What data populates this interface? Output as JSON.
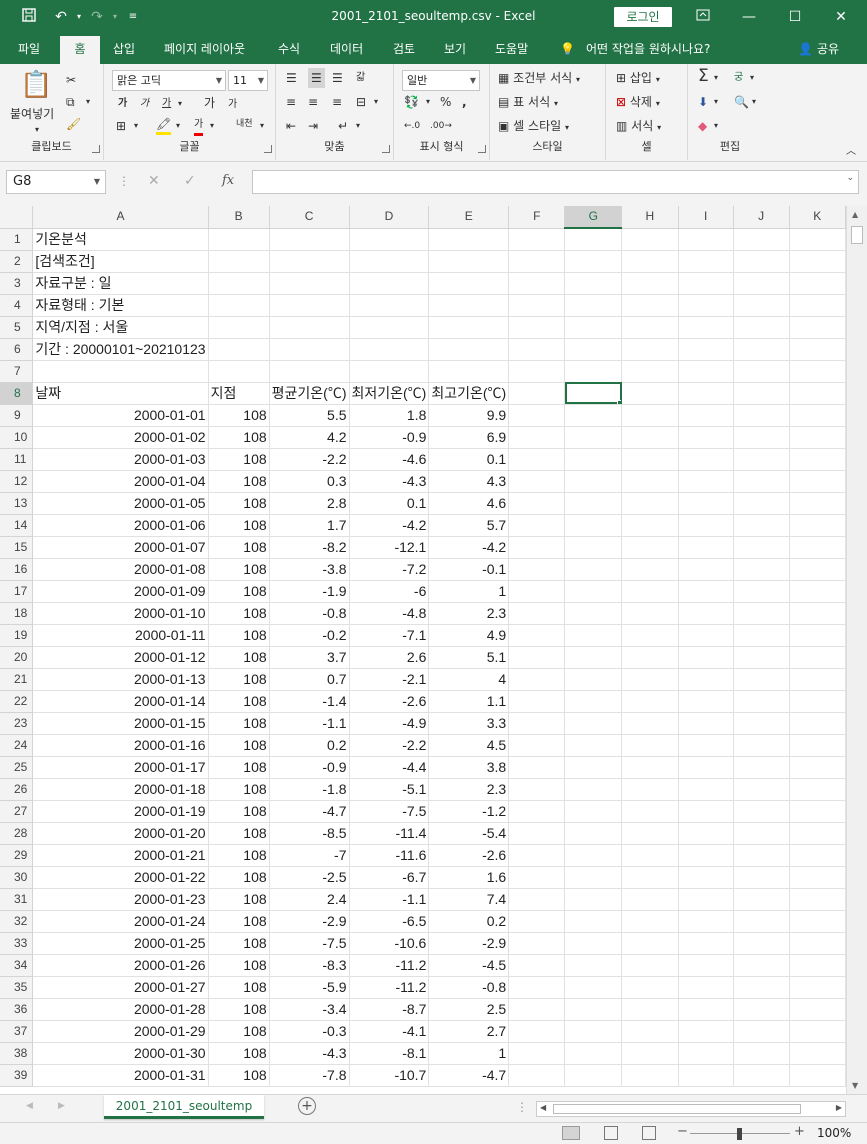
{
  "window": {
    "title": "2001_2101_seoultemp.csv  -  Excel",
    "login": "로그인",
    "accent": "#217346"
  },
  "tabs": [
    "파일",
    "홈",
    "삽입",
    "페이지 레이아웃",
    "수식",
    "데이터",
    "검토",
    "보기",
    "도움말"
  ],
  "tellme": "어떤 작업을 원하시나요?",
  "share": "공유",
  "ribbon": {
    "clipboard": {
      "paste": "붙여넣기",
      "label": "클립보드"
    },
    "font": {
      "name": "맑은 고딕",
      "size": "11",
      "label": "글꼴",
      "bold": "가",
      "italic": "가",
      "underline": "가",
      "grow": "가",
      "shrink": "가",
      "phonetic": "내천"
    },
    "align": {
      "label": "맞춤",
      "wrap": "갋"
    },
    "number": {
      "format": "일반",
      "label": "표시 형식"
    },
    "styles": {
      "conditional": "조건부 서식",
      "table": "표 서식",
      "cell": "셀 스타일",
      "label": "스타일"
    },
    "cells": {
      "insert": "삽입",
      "delete": "삭제",
      "format": "서식",
      "label": "셀"
    },
    "editing": {
      "label": "편집",
      "sort": "궁"
    }
  },
  "formula": {
    "namebox": "G8",
    "value": ""
  },
  "columns": [
    "A",
    "B",
    "C",
    "D",
    "E",
    "F",
    "G",
    "H",
    "I",
    "J",
    "K"
  ],
  "selected_column": "G",
  "selected_row": 8,
  "header_rows": [
    "기온분석",
    "[검색조건]",
    "자료구분 : 일",
    "자료형태 : 기본",
    "지역/지점 : 서울",
    "기간 : 20000101~20210123",
    ""
  ],
  "table_header": [
    "날짜",
    "지점",
    "평균기온(℃)",
    "최저기온(℃)",
    "최고기온(℃)"
  ],
  "rows": [
    [
      "2000-01-01",
      "108",
      "5.5",
      "1.8",
      "9.9"
    ],
    [
      "2000-01-02",
      "108",
      "4.2",
      "-0.9",
      "6.9"
    ],
    [
      "2000-01-03",
      "108",
      "-2.2",
      "-4.6",
      "0.1"
    ],
    [
      "2000-01-04",
      "108",
      "0.3",
      "-4.3",
      "4.3"
    ],
    [
      "2000-01-05",
      "108",
      "2.8",
      "0.1",
      "4.6"
    ],
    [
      "2000-01-06",
      "108",
      "1.7",
      "-4.2",
      "5.7"
    ],
    [
      "2000-01-07",
      "108",
      "-8.2",
      "-12.1",
      "-4.2"
    ],
    [
      "2000-01-08",
      "108",
      "-3.8",
      "-7.2",
      "-0.1"
    ],
    [
      "2000-01-09",
      "108",
      "-1.9",
      "-6",
      "1"
    ],
    [
      "2000-01-10",
      "108",
      "-0.8",
      "-4.8",
      "2.3"
    ],
    [
      "2000-01-11",
      "108",
      "-0.2",
      "-7.1",
      "4.9"
    ],
    [
      "2000-01-12",
      "108",
      "3.7",
      "2.6",
      "5.1"
    ],
    [
      "2000-01-13",
      "108",
      "0.7",
      "-2.1",
      "4"
    ],
    [
      "2000-01-14",
      "108",
      "-1.4",
      "-2.6",
      "1.1"
    ],
    [
      "2000-01-15",
      "108",
      "-1.1",
      "-4.9",
      "3.3"
    ],
    [
      "2000-01-16",
      "108",
      "0.2",
      "-2.2",
      "4.5"
    ],
    [
      "2000-01-17",
      "108",
      "-0.9",
      "-4.4",
      "3.8"
    ],
    [
      "2000-01-18",
      "108",
      "-1.8",
      "-5.1",
      "2.3"
    ],
    [
      "2000-01-19",
      "108",
      "-4.7",
      "-7.5",
      "-1.2"
    ],
    [
      "2000-01-20",
      "108",
      "-8.5",
      "-11.4",
      "-5.4"
    ],
    [
      "2000-01-21",
      "108",
      "-7",
      "-11.6",
      "-2.6"
    ],
    [
      "2000-01-22",
      "108",
      "-2.5",
      "-6.7",
      "1.6"
    ],
    [
      "2000-01-23",
      "108",
      "2.4",
      "-1.1",
      "7.4"
    ],
    [
      "2000-01-24",
      "108",
      "-2.9",
      "-6.5",
      "0.2"
    ],
    [
      "2000-01-25",
      "108",
      "-7.5",
      "-10.6",
      "-2.9"
    ],
    [
      "2000-01-26",
      "108",
      "-8.3",
      "-11.2",
      "-4.5"
    ],
    [
      "2000-01-27",
      "108",
      "-5.9",
      "-11.2",
      "-0.8"
    ],
    [
      "2000-01-28",
      "108",
      "-3.4",
      "-8.7",
      "2.5"
    ],
    [
      "2000-01-29",
      "108",
      "-0.3",
      "-4.1",
      "2.7"
    ],
    [
      "2000-01-30",
      "108",
      "-4.3",
      "-8.1",
      "1"
    ],
    [
      "2000-01-31",
      "108",
      "-7.8",
      "-10.7",
      "-4.7"
    ]
  ],
  "sheet_tab": "2001_2101_seoultemp",
  "zoom": "100%"
}
